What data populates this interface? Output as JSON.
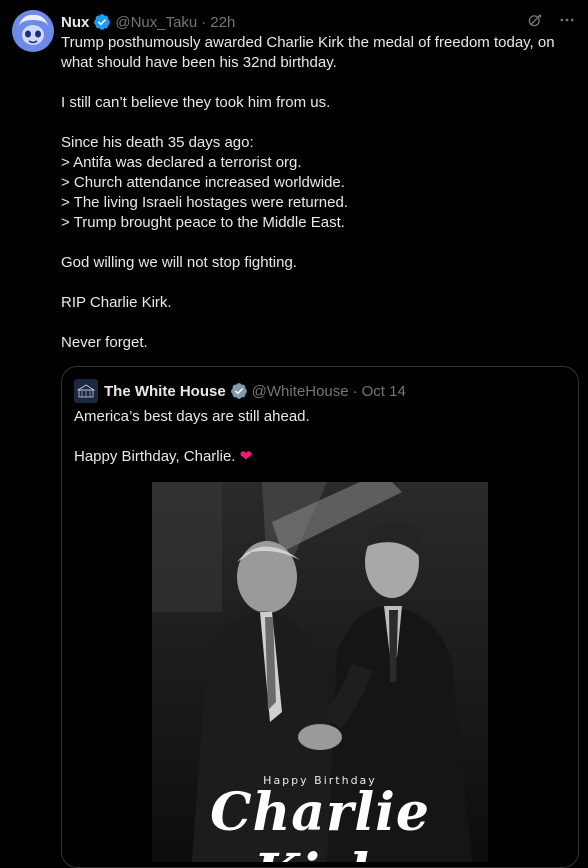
{
  "tweet": {
    "author_name": "Nux",
    "author_handle": "@Nux_Taku",
    "separator": "·",
    "time": "22h",
    "text": "Trump posthumously awarded Charlie Kirk the medal of freedom today, on what should have been his 32nd birthday.\n\nI still can’t believe they took him from us.\n\nSince his death 35 days ago:\n> Antifa was declared a terrorist org.\n> Church attendance increased worldwide.\n> The living Israeli hostages were returned.\n> Trump brought peace to the Middle East.\n\nGod willing we will not stop fighting.\n\nRIP Charlie Kirk.\n\nNever forget."
  },
  "quote": {
    "author_name": "The White House",
    "author_handle": "@WhiteHouse",
    "separator": "·",
    "date": "Oct 14",
    "text_line1": "America’s best days are still ahead.",
    "text_line2": "Happy Birthday, Charlie. ",
    "heart_glyph": "❤"
  },
  "photo": {
    "overlay_small": "Happy Birthday",
    "overlay_large": "Charlie Kirk"
  },
  "icons": {
    "verified": "verified-badge-icon",
    "grok": "grok-icon",
    "more": "more-options-icon"
  },
  "colors": {
    "background": "#000000",
    "text": "#e7e9ea",
    "muted": "#71767b",
    "verified_blue": "#1d9bf0",
    "verified_gray": "#829aab",
    "heart": "#f91880",
    "border": "#2f3336"
  }
}
